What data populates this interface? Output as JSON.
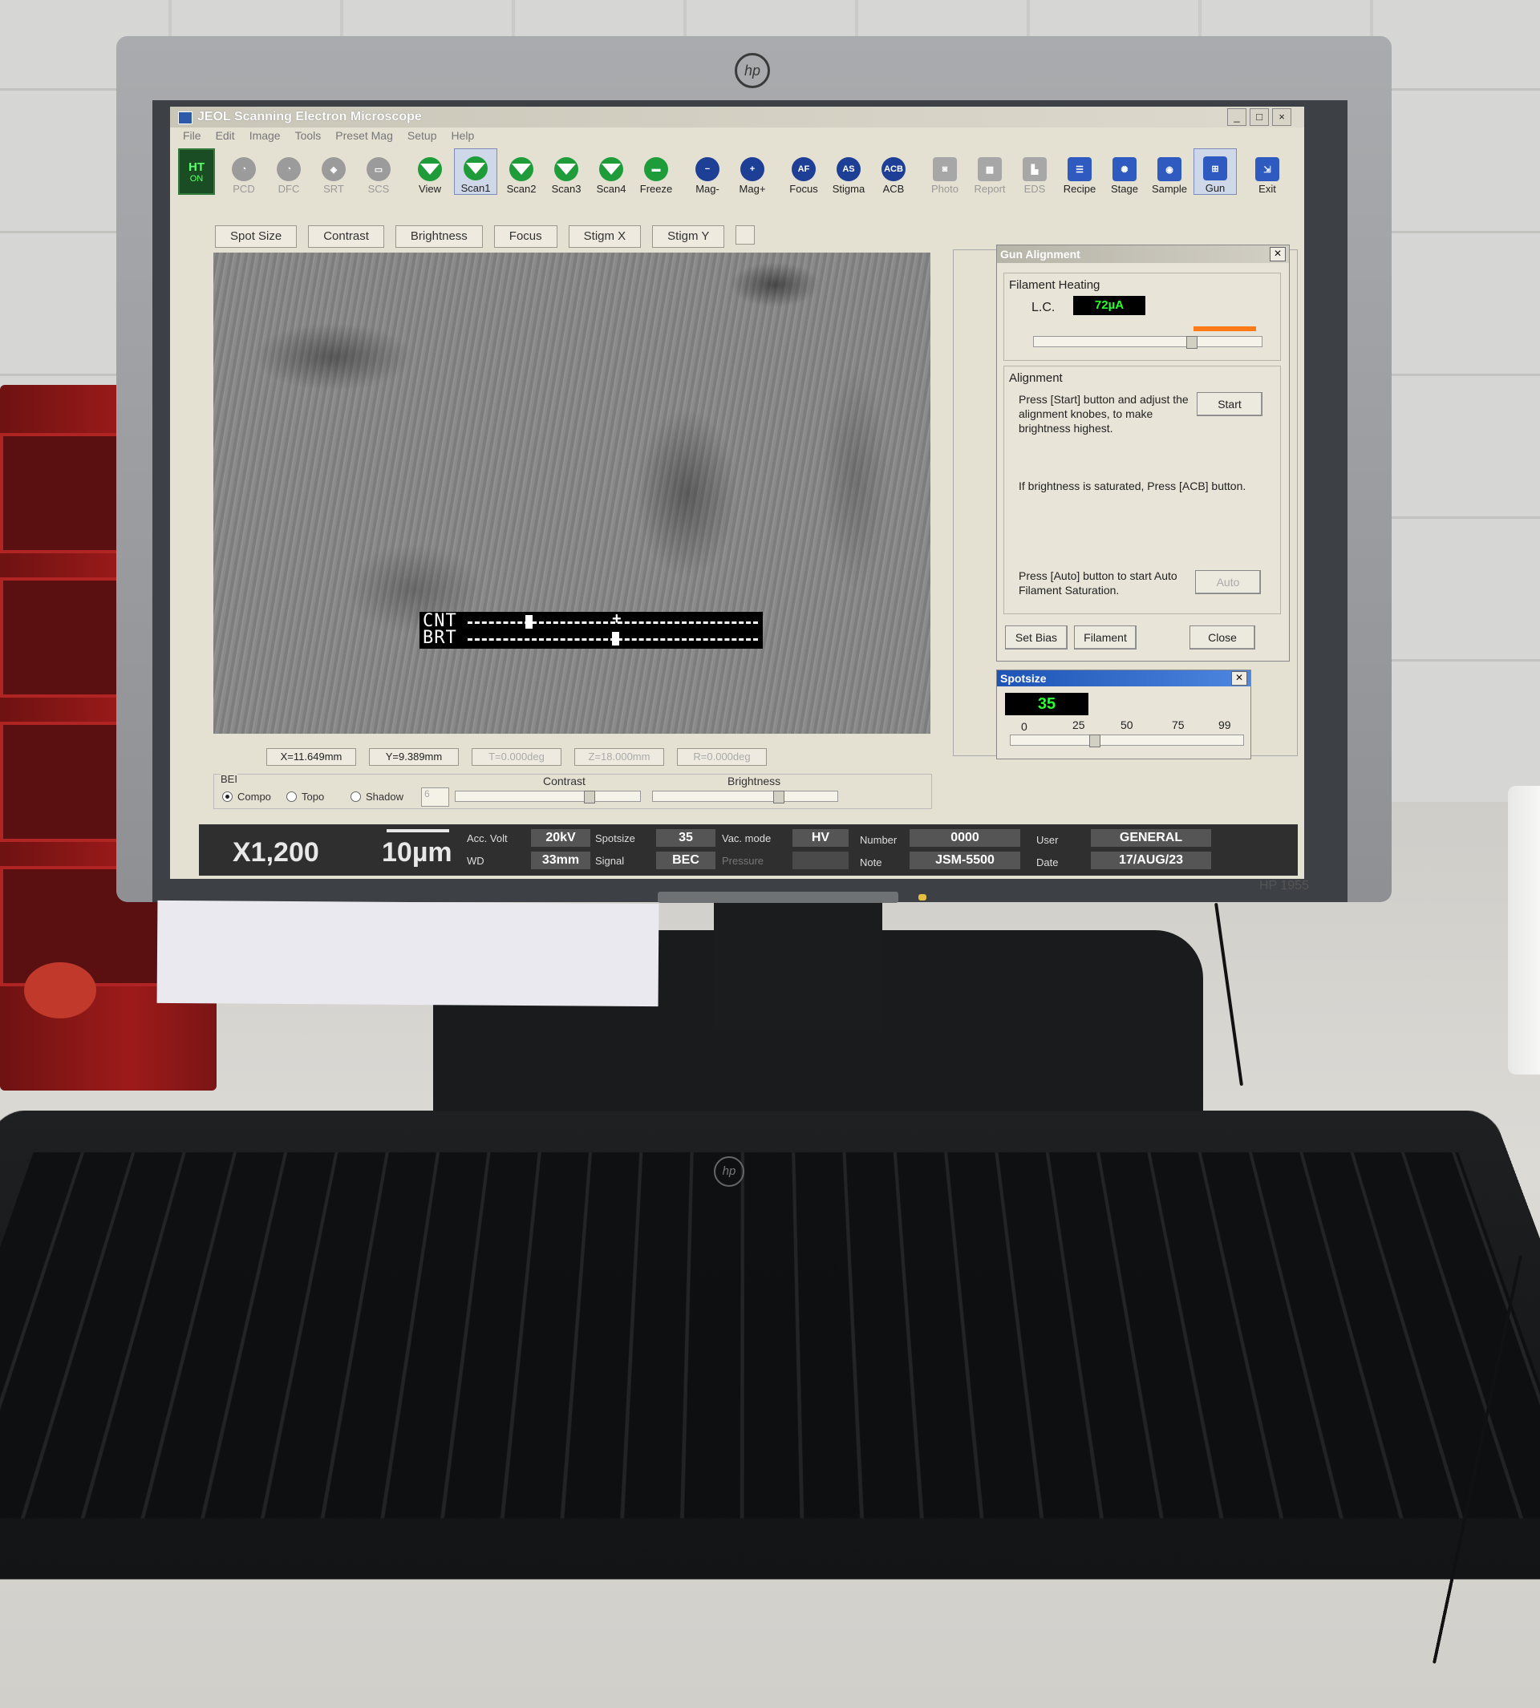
{
  "window": {
    "title": "JEOL Scanning Electron Microscope",
    "controls": [
      "_",
      "□",
      "×"
    ]
  },
  "menu": [
    "File",
    "Edit",
    "Image",
    "Tools",
    "Preset Mag",
    "Setup",
    "Help"
  ],
  "toolbar": {
    "ht": {
      "label": "HT",
      "state": "ON"
    },
    "buttons": [
      {
        "label": "PCD",
        "icon": "gauge-icon"
      },
      {
        "label": "DFC",
        "icon": "gauge-icon"
      },
      {
        "label": "SRT",
        "icon": "target-icon"
      },
      {
        "label": "SCS",
        "icon": "scs-icon"
      },
      {
        "label": "View",
        "icon": "scan-triangle-icon"
      },
      {
        "label": "Scan1",
        "icon": "scan-triangle-icon"
      },
      {
        "label": "Scan2",
        "icon": "scan-triangle-icon"
      },
      {
        "label": "Scan3",
        "icon": "scan-triangle-icon"
      },
      {
        "label": "Scan4",
        "icon": "scan-triangle-icon"
      },
      {
        "label": "Freeze",
        "icon": "freeze-icon"
      },
      {
        "label": "Mag-",
        "icon": "minus-icon"
      },
      {
        "label": "Mag+",
        "icon": "plus-icon"
      },
      {
        "label": "Focus",
        "icon": "af-icon",
        "glyph": "AF"
      },
      {
        "label": "Stigma",
        "icon": "as-icon",
        "glyph": "AS"
      },
      {
        "label": "ACB",
        "icon": "acb-icon",
        "glyph": "ACB"
      },
      {
        "label": "Photo",
        "icon": "camera-icon"
      },
      {
        "label": "Report",
        "icon": "report-icon"
      },
      {
        "label": "EDS",
        "icon": "spectrum-icon"
      },
      {
        "label": "Recipe",
        "icon": "list-icon"
      },
      {
        "label": "Stage",
        "icon": "stage-icon"
      },
      {
        "label": "Sample",
        "icon": "sample-icon"
      },
      {
        "label": "Gun",
        "icon": "gun-icon"
      },
      {
        "label": "Exit",
        "icon": "exit-icon"
      }
    ]
  },
  "tabs": [
    "Spot Size",
    "Contrast",
    "Brightness",
    "Focus",
    "Stigm X",
    "Stigm Y"
  ],
  "image_overlay": {
    "cnt_label": "CNT",
    "brt_label": "BRT",
    "cnt_level": 0.2,
    "brt_level": 0.5
  },
  "coords": {
    "x": "X=11.649mm",
    "y": "Y=9.389mm",
    "t": "T=0.000deg",
    "z": "Z=18.000mm",
    "r": "R=0.000deg"
  },
  "detector": {
    "label": "BEI",
    "modes": [
      "Compo",
      "Topo",
      "Shadow"
    ],
    "selected": "Compo",
    "shadow_value": "6",
    "contrast_label": "Contrast",
    "brightness_label": "Brightness"
  },
  "status": {
    "magnification": "X1,200",
    "scale": "10µm",
    "acc_volt_label": "Acc. Volt",
    "acc_volt": "20kV",
    "wd_label": "WD",
    "wd": "33mm",
    "spotsize_label": "Spotsize",
    "spotsize": "35",
    "signal_label": "Signal",
    "signal": "BEC",
    "vac_mode_label": "Vac. mode",
    "vac_mode": "HV",
    "pressure_label": "Pressure",
    "number_label": "Number",
    "number": "0000",
    "note_label": "Note",
    "note": "JSM-5500",
    "user_label": "User",
    "user": "GENERAL",
    "date_label": "Date",
    "date": "17/AUG/23"
  },
  "gun_alignment": {
    "title": "Gun Alignment",
    "filament_heating_label": "Filament Heating",
    "lc_label": "L.C.",
    "lc_value": "72µA",
    "alignment_label": "Alignment",
    "instruction1": "Press [Start] button and adjust the alignment knobes, to make brightness highest.",
    "instruction2": "If brightness is saturated, Press [ACB] button.",
    "instruction3": "Press [Auto] button to start Auto Filament Saturation.",
    "start_button": "Start",
    "auto_button": "Auto",
    "set_bias_button": "Set Bias",
    "filament_button": "Filament",
    "close_button": "Close"
  },
  "spotsize_dialog": {
    "title": "Spotsize",
    "value": "35",
    "ticks": [
      "0",
      "25",
      "50",
      "75",
      "99"
    ],
    "level": 35
  },
  "hardware": {
    "monitor_model": "HP 1955",
    "brand_glyph": "hp"
  },
  "colors": {
    "lcd_green": "#27ff2f",
    "toolbar_green": "#1f9c3a",
    "toolbar_blue": "#1d3f95",
    "spotsize_title": "#1d54b5",
    "filament_orange": "#ff7b18"
  }
}
